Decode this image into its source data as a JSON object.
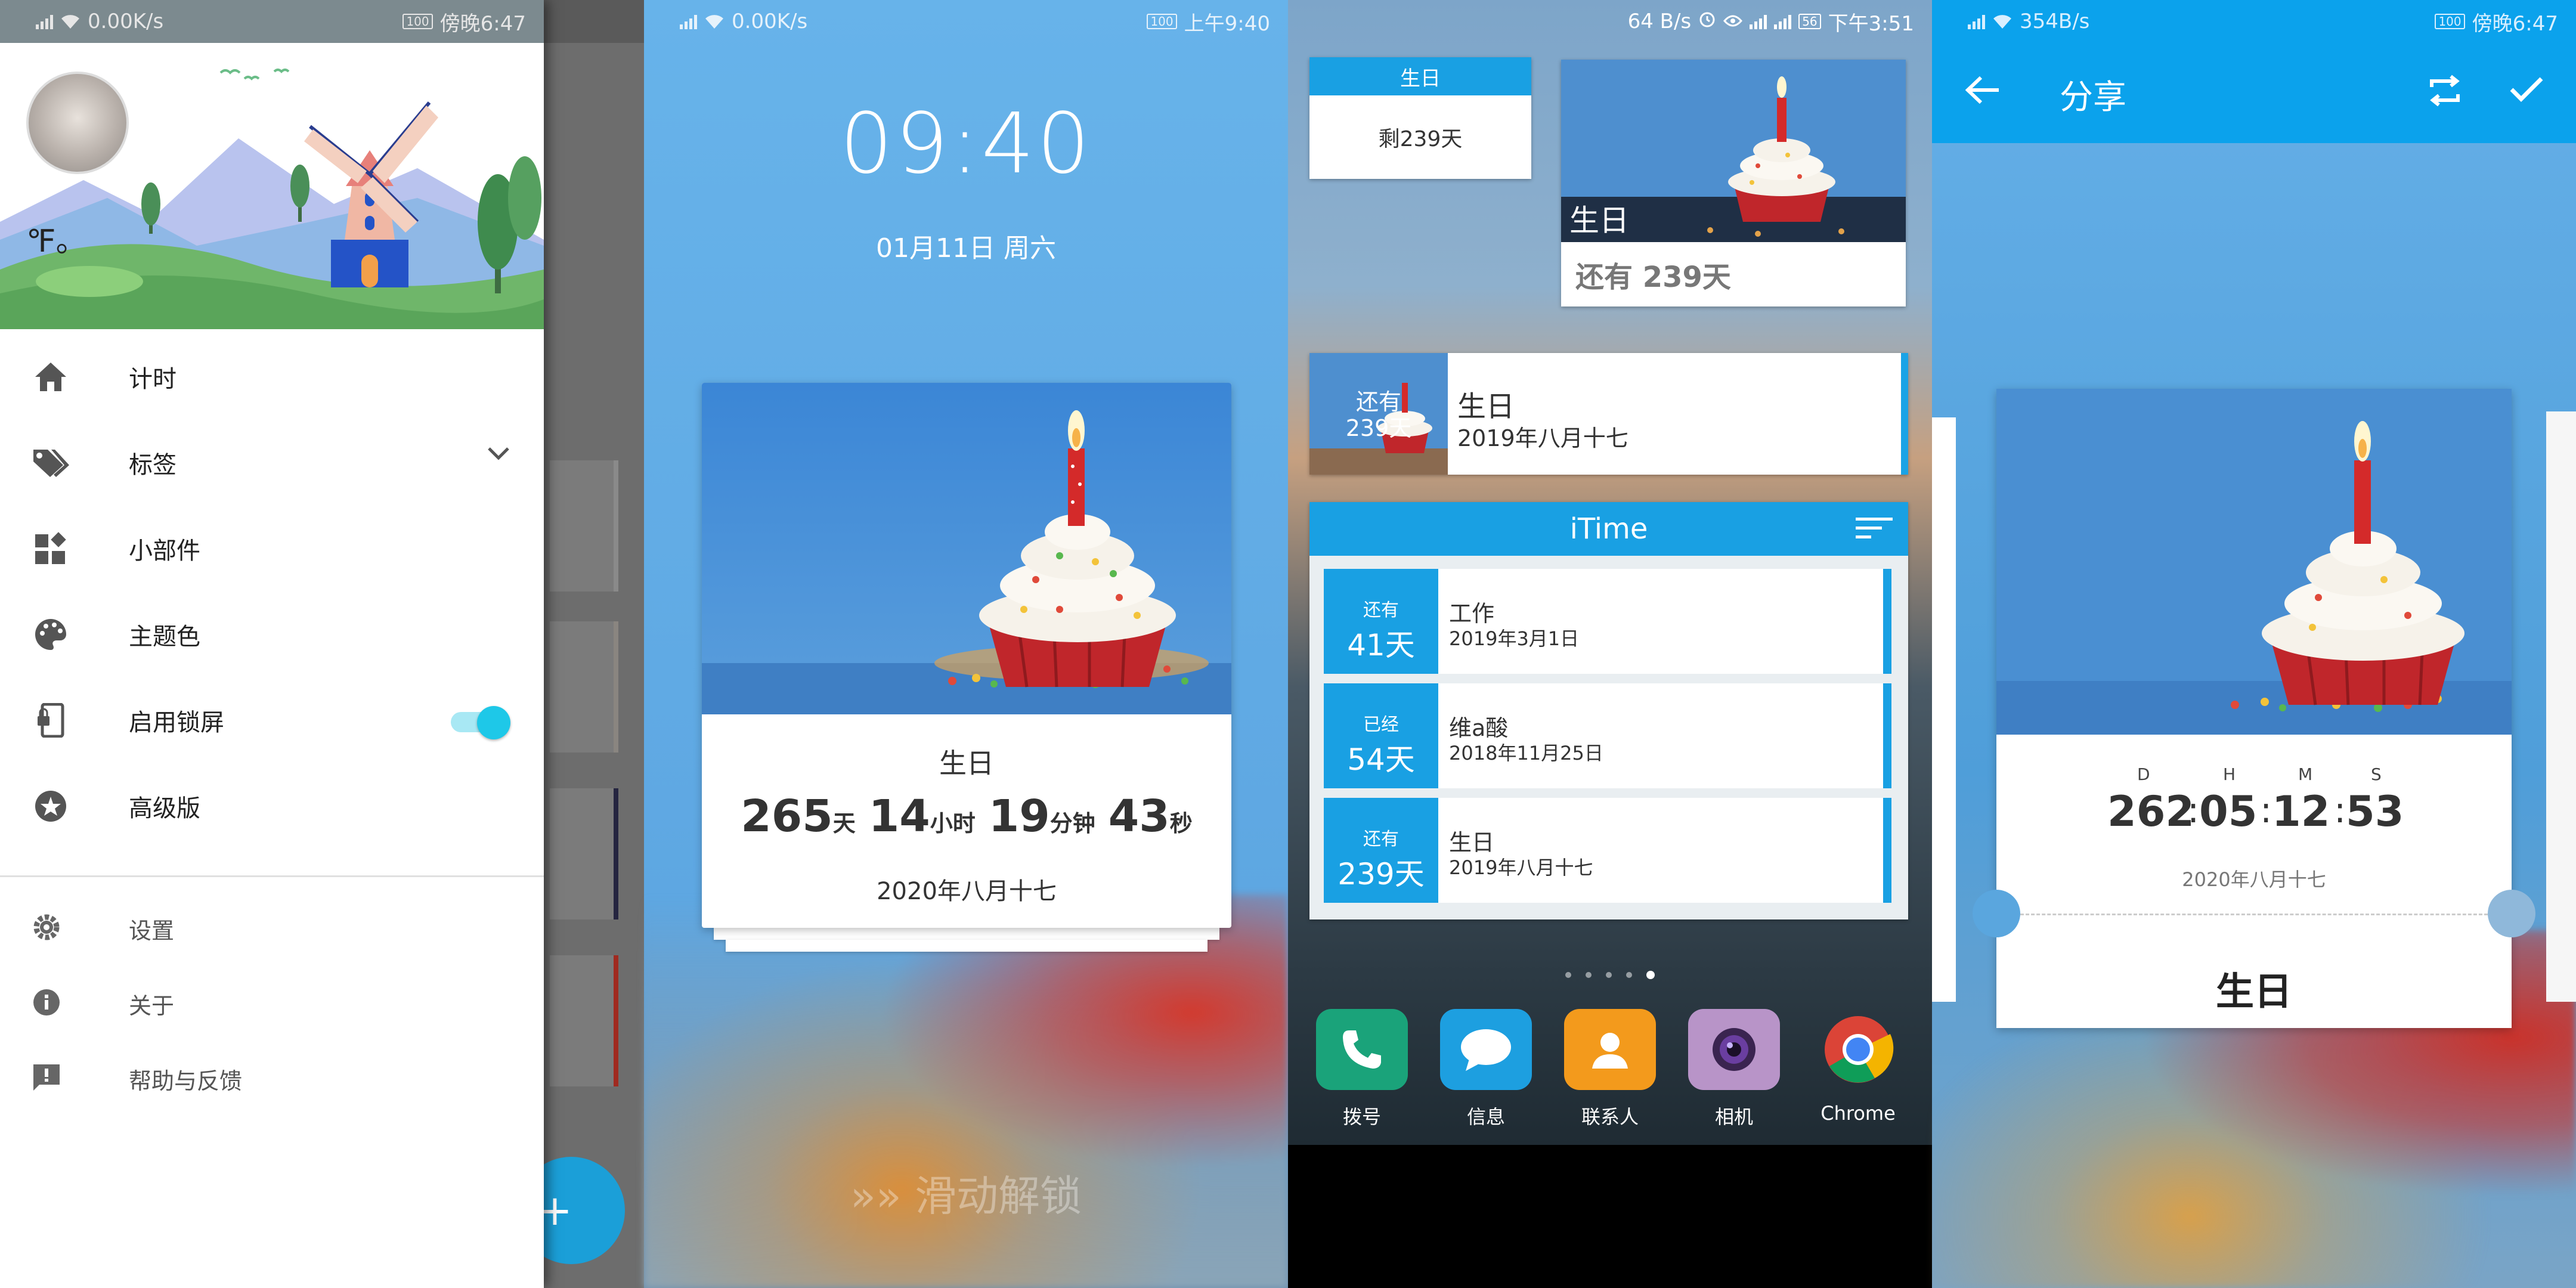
{
  "panel1": {
    "status": {
      "speed": "0.00K/s",
      "battery": "100",
      "time": "傍晚6:47"
    },
    "header": {
      "temperature_unit": "℉。"
    },
    "menu": [
      {
        "icon": "home-icon",
        "label": "计时"
      },
      {
        "icon": "tag-icon",
        "label": "标签"
      },
      {
        "icon": "widgets-icon",
        "label": "小部件"
      },
      {
        "icon": "palette-icon",
        "label": "主题色"
      },
      {
        "icon": "lock-screen-icon",
        "label": "启用锁屏"
      },
      {
        "icon": "star-icon",
        "label": "高级版"
      }
    ],
    "secondary_menu": [
      {
        "icon": "gear-icon",
        "label": "设置"
      },
      {
        "icon": "info-icon",
        "label": "关于"
      },
      {
        "icon": "feedback-icon",
        "label": "帮助与反馈"
      }
    ],
    "lock_screen_enabled": true,
    "fab_label": "+"
  },
  "panel2": {
    "status": {
      "speed": "0.00K/s",
      "battery": "100",
      "time": "上午9:40"
    },
    "clock": "09:40",
    "date": "01月11日 周六",
    "card": {
      "title": "生日",
      "days": "265",
      "days_unit": "天",
      "hours": "14",
      "hours_unit": "小时",
      "minutes": "19",
      "minutes_unit": "分钟",
      "seconds": "43",
      "seconds_unit": "秒",
      "date": "2020年八月十七"
    },
    "unlock_text": "滑动解锁"
  },
  "panel3": {
    "status": {
      "speed": "64 B/s",
      "battery": "56",
      "time": "下午3:51"
    },
    "small_widget": {
      "title": "生日",
      "remaining": "剩239天"
    },
    "big_widget": {
      "label": "生日",
      "remaining": "还有 239天"
    },
    "row_widget": {
      "overlay_top": "还有",
      "overlay_bottom": "239天",
      "title": "生日",
      "date": "2019年八月十七"
    },
    "itime": {
      "title": "iTime",
      "items": [
        {
          "status": "还有",
          "days": "41天",
          "title": "工作",
          "date": "2019年3月1日"
        },
        {
          "status": "已经",
          "days": "54天",
          "title": "维a酸",
          "date": "2018年11月25日"
        },
        {
          "status": "还有",
          "days": "239天",
          "title": "生日",
          "date": "2019年八月十七"
        }
      ]
    },
    "dock": [
      {
        "name": "拨号",
        "icon": "phone-icon",
        "color": "#1aa37a"
      },
      {
        "name": "信息",
        "icon": "message-icon",
        "color": "#1d9fe0"
      },
      {
        "name": "联系人",
        "icon": "contacts-icon",
        "color": "#f39a1c"
      },
      {
        "name": "相机",
        "icon": "camera-icon",
        "color": "#b894c8"
      },
      {
        "name": "Chrome",
        "icon": "chrome-icon",
        "color": "#ffffff"
      }
    ]
  },
  "panel4": {
    "status": {
      "speed": "354B/s",
      "battery": "100",
      "time": "傍晚6:47"
    },
    "title": "分享",
    "card": {
      "labels": [
        "D",
        "H",
        "M",
        "S"
      ],
      "values": [
        "262",
        "05",
        "12",
        "53"
      ],
      "date": "2020年八月十七",
      "name": "生日"
    }
  },
  "colors": {
    "accent": "#19a0e3",
    "toggle": "#1ec8e8",
    "appbar": "#0ba2ec"
  }
}
